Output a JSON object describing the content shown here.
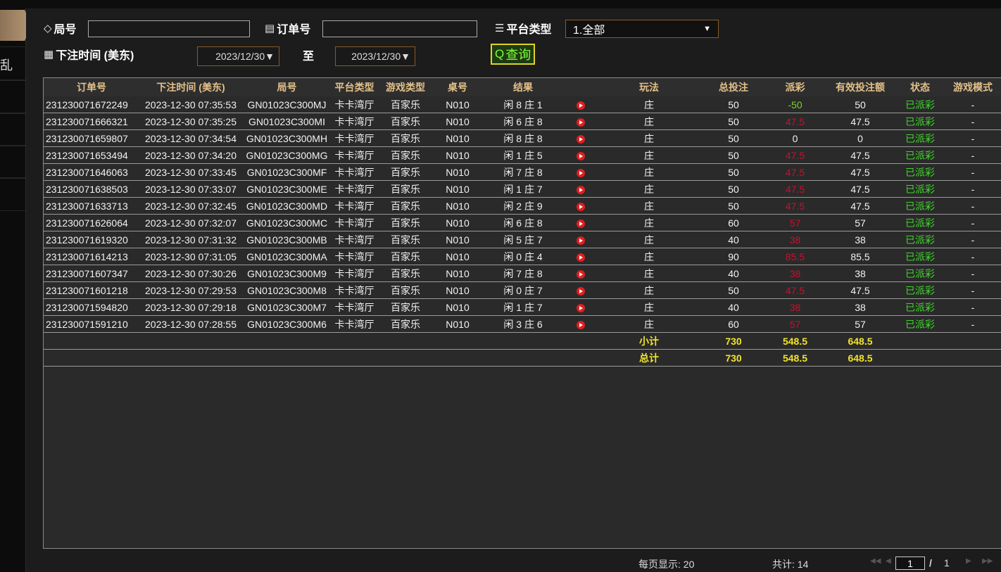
{
  "nav": {
    "items": [
      "",
      "乱",
      "",
      "",
      "",
      ""
    ]
  },
  "filters": {
    "round_label": "局号",
    "round_value": "",
    "order_label": "订单号",
    "order_value": "",
    "platform_label": "平台类型",
    "platform_value": "1.全部",
    "time_label": "下注时间 (美东)",
    "date_from": "2023/12/30▼",
    "to_label": "至",
    "date_to": "2023/12/30▼",
    "query_label": "查询"
  },
  "table": {
    "headers": [
      "订单号",
      "下注时间 (美东)",
      "局号",
      "平台类型",
      "游戏类型",
      "桌号",
      "结果",
      "",
      "玩法",
      "总投注",
      "派彩",
      "有效投注额",
      "状态",
      "游戏模式"
    ],
    "rows": [
      [
        "231230071672249",
        "2023-12-30 07:35:53",
        "GN01023C300MJ",
        "卡卡湾厅",
        "百家乐",
        "N010",
        "闲 8 庄 1",
        "庄",
        "50",
        "-50",
        "50",
        "已派彩",
        "-"
      ],
      [
        "231230071666321",
        "2023-12-30 07:35:25",
        "GN01023C300MI",
        "卡卡湾厅",
        "百家乐",
        "N010",
        "闲 6 庄 8",
        "庄",
        "50",
        "47.5",
        "47.5",
        "已派彩",
        "-"
      ],
      [
        "231230071659807",
        "2023-12-30 07:34:54",
        "GN01023C300MH",
        "卡卡湾厅",
        "百家乐",
        "N010",
        "闲 8 庄 8",
        "庄",
        "50",
        "0",
        "0",
        "已派彩",
        "-"
      ],
      [
        "231230071653494",
        "2023-12-30 07:34:20",
        "GN01023C300MG",
        "卡卡湾厅",
        "百家乐",
        "N010",
        "闲 1 庄 5",
        "庄",
        "50",
        "47.5",
        "47.5",
        "已派彩",
        "-"
      ],
      [
        "231230071646063",
        "2023-12-30 07:33:45",
        "GN01023C300MF",
        "卡卡湾厅",
        "百家乐",
        "N010",
        "闲 7 庄 8",
        "庄",
        "50",
        "47.5",
        "47.5",
        "已派彩",
        "-"
      ],
      [
        "231230071638503",
        "2023-12-30 07:33:07",
        "GN01023C300ME",
        "卡卡湾厅",
        "百家乐",
        "N010",
        "闲 1 庄 7",
        "庄",
        "50",
        "47.5",
        "47.5",
        "已派彩",
        "-"
      ],
      [
        "231230071633713",
        "2023-12-30 07:32:45",
        "GN01023C300MD",
        "卡卡湾厅",
        "百家乐",
        "N010",
        "闲 2 庄 9",
        "庄",
        "50",
        "47.5",
        "47.5",
        "已派彩",
        "-"
      ],
      [
        "231230071626064",
        "2023-12-30 07:32:07",
        "GN01023C300MC",
        "卡卡湾厅",
        "百家乐",
        "N010",
        "闲 6 庄 8",
        "庄",
        "60",
        "57",
        "57",
        "已派彩",
        "-"
      ],
      [
        "231230071619320",
        "2023-12-30 07:31:32",
        "GN01023C300MB",
        "卡卡湾厅",
        "百家乐",
        "N010",
        "闲 5 庄 7",
        "庄",
        "40",
        "38",
        "38",
        "已派彩",
        "-"
      ],
      [
        "231230071614213",
        "2023-12-30 07:31:05",
        "GN01023C300MA",
        "卡卡湾厅",
        "百家乐",
        "N010",
        "闲 0 庄 4",
        "庄",
        "90",
        "85.5",
        "85.5",
        "已派彩",
        "-"
      ],
      [
        "231230071607347",
        "2023-12-30 07:30:26",
        "GN01023C300M9",
        "卡卡湾厅",
        "百家乐",
        "N010",
        "闲 7 庄 8",
        "庄",
        "40",
        "38",
        "38",
        "已派彩",
        "-"
      ],
      [
        "231230071601218",
        "2023-12-30 07:29:53",
        "GN01023C300M8",
        "卡卡湾厅",
        "百家乐",
        "N010",
        "闲 0 庄 7",
        "庄",
        "50",
        "47.5",
        "47.5",
        "已派彩",
        "-"
      ],
      [
        "231230071594820",
        "2023-12-30 07:29:18",
        "GN01023C300M7",
        "卡卡湾厅",
        "百家乐",
        "N010",
        "闲 1 庄 7",
        "庄",
        "40",
        "38",
        "38",
        "已派彩",
        "-"
      ],
      [
        "231230071591210",
        "2023-12-30 07:28:55",
        "GN01023C300M6",
        "卡卡湾厅",
        "百家乐",
        "N010",
        "闲 3 庄 6",
        "庄",
        "60",
        "57",
        "57",
        "已派彩",
        "-"
      ]
    ],
    "subtotal": {
      "label": "小计",
      "bet": "730",
      "payout": "548.5",
      "valid": "648.5"
    },
    "total": {
      "label": "总计",
      "bet": "730",
      "payout": "548.5",
      "valid": "648.5"
    }
  },
  "footer": {
    "per_page": "每页显示: 20",
    "total_count": "共计: 14",
    "current_page": "1",
    "separator": "/",
    "total_pages": "1"
  },
  "colors": {
    "header_text": "#e3c08a",
    "sum_text": "#f1e42b",
    "payout_red": "#c8102e",
    "status_green": "#3ed62a",
    "accent_border": "#8a5a2a"
  }
}
